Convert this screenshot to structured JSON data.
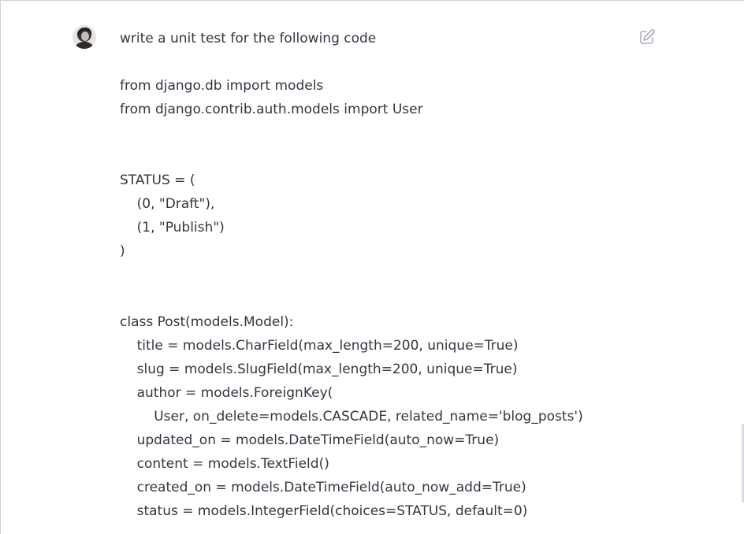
{
  "user_message": {
    "avatar_icon": "user-avatar-icon",
    "edit_icon": "edit-icon",
    "lines": [
      "write a unit test for the following code",
      "",
      "from django.db import models",
      "from django.contrib.auth.models import User",
      "",
      "",
      "STATUS = (",
      "    (0, \"Draft\"),",
      "    (1, \"Publish\")",
      ")",
      "",
      "",
      "class Post(models.Model):",
      "    title = models.CharField(max_length=200, unique=True)",
      "    slug = models.SlugField(max_length=200, unique=True)",
      "    author = models.ForeignKey(",
      "        User, on_delete=models.CASCADE, related_name='blog_posts')",
      "    updated_on = models.DateTimeField(auto_now=True)",
      "    content = models.TextField()",
      "    created_on = models.DateTimeField(auto_now_add=True)",
      "    status = models.IntegerField(choices=STATUS, default=0)"
    ]
  },
  "colors": {
    "text": "#343541",
    "icon": "#acacbe",
    "border": "#d0d2d9"
  }
}
